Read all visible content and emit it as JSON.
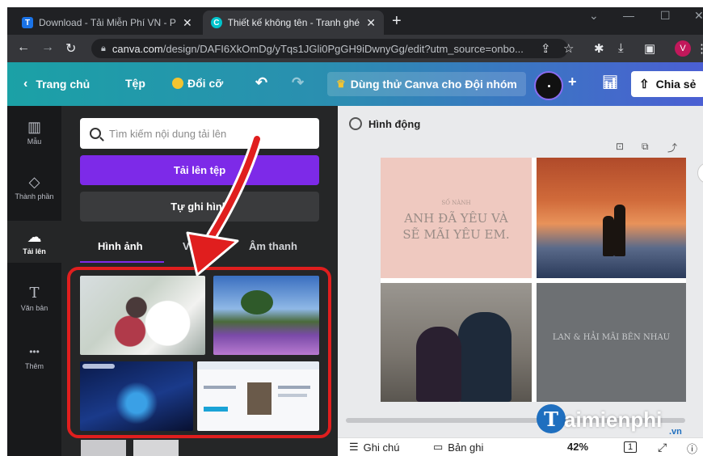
{
  "browser": {
    "tabs": [
      {
        "title": "Download - Tải Miễn Phí VN - Ph",
        "favicon": "T",
        "favicon_color": "#1a73e8"
      },
      {
        "title": "Thiết kế không tên - Tranh ghép",
        "favicon": "C",
        "favicon_color": "#00c4cc"
      }
    ],
    "new_tab": "+",
    "url_host": "canva.com",
    "url_rest": "/design/DAFI6XkOmDg/yTqs1JGli0PgGH9iDwnyGg/edit?utm_source=onbo...",
    "avatar_letter": "V"
  },
  "header": {
    "home": "Trang chủ",
    "file": "Tệp",
    "resize": "Đổi cỡ",
    "trial": "Dùng thử Canva cho Đội nhóm",
    "add": "+",
    "share": "Chia sẻ"
  },
  "rail": {
    "items": [
      {
        "label": "Mẫu",
        "icon": "▥"
      },
      {
        "label": "Thành phần",
        "icon": "◇"
      },
      {
        "label": "Tải lên",
        "icon": "☁"
      },
      {
        "label": "Văn bản",
        "icon": "T"
      },
      {
        "label": "Thêm",
        "icon": "•••"
      }
    ]
  },
  "panel": {
    "search_placeholder": "Tìm kiếm nội dung tải lên",
    "upload_button": "Tải lên tệp",
    "record_button": "Tự ghi hình",
    "tabs": [
      "Hình ảnh",
      "Video",
      "Âm thanh"
    ]
  },
  "canvas": {
    "animate": "Hình động",
    "cell1_small": "SỐ NÀNH",
    "cell1_line1": "ANH ĐÃ YÊU VÀ",
    "cell1_line2": "SẼ MÃI YÊU EM.",
    "cell4_text": "LAN & HẢI MÃI BÊN NHAU"
  },
  "footer": {
    "notes": "Ghi chú",
    "record": "Bản ghi",
    "zoom": "42%",
    "page": "1"
  },
  "watermark": {
    "brand": "aimienphi",
    "suffix": ".vn",
    "initial": "T"
  },
  "colors": {
    "header_start": "#1ba1a6",
    "header_end": "#4b5fd3",
    "upload_purple": "#7d2ae8",
    "highlight_red": "#e01e1e"
  }
}
